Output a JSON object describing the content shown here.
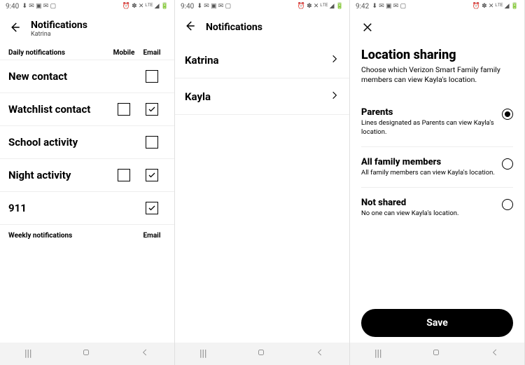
{
  "panes": {
    "left": {
      "status": {
        "time": "9:40"
      },
      "header": {
        "title": "Notifications",
        "subtitle": "Katrina"
      },
      "table": {
        "header_label": "Daily notifications",
        "col_mobile": "Mobile",
        "col_email": "Email",
        "rows": [
          {
            "label": "New contact",
            "mobile": null,
            "email": false
          },
          {
            "label": "Watchlist contact",
            "mobile": false,
            "email": true
          },
          {
            "label": "School activity",
            "mobile": null,
            "email": false
          },
          {
            "label": "Night activity",
            "mobile": false,
            "email": true
          },
          {
            "label": "911",
            "mobile": null,
            "email": true
          }
        ],
        "footer_label": "Weekly notifications",
        "footer_col": "Email"
      }
    },
    "middle": {
      "status": {
        "time": "9:40"
      },
      "header": {
        "title": "Notifications"
      },
      "people": [
        {
          "name": "Katrina"
        },
        {
          "name": "Kayla"
        }
      ]
    },
    "right": {
      "status": {
        "time": "9:42"
      },
      "title": "Location sharing",
      "description": "Choose which Verizon Smart Family family members can view Kayla's location.",
      "options": [
        {
          "title": "Parents",
          "sub": "Lines designated as Parents can view Kayla's location.",
          "selected": true
        },
        {
          "title": "All family members",
          "sub": "All family members can view Kayla's location.",
          "selected": false
        },
        {
          "title": "Not shared",
          "sub": "No one can view Kayla's location.",
          "selected": false
        }
      ],
      "save_label": "Save"
    }
  }
}
